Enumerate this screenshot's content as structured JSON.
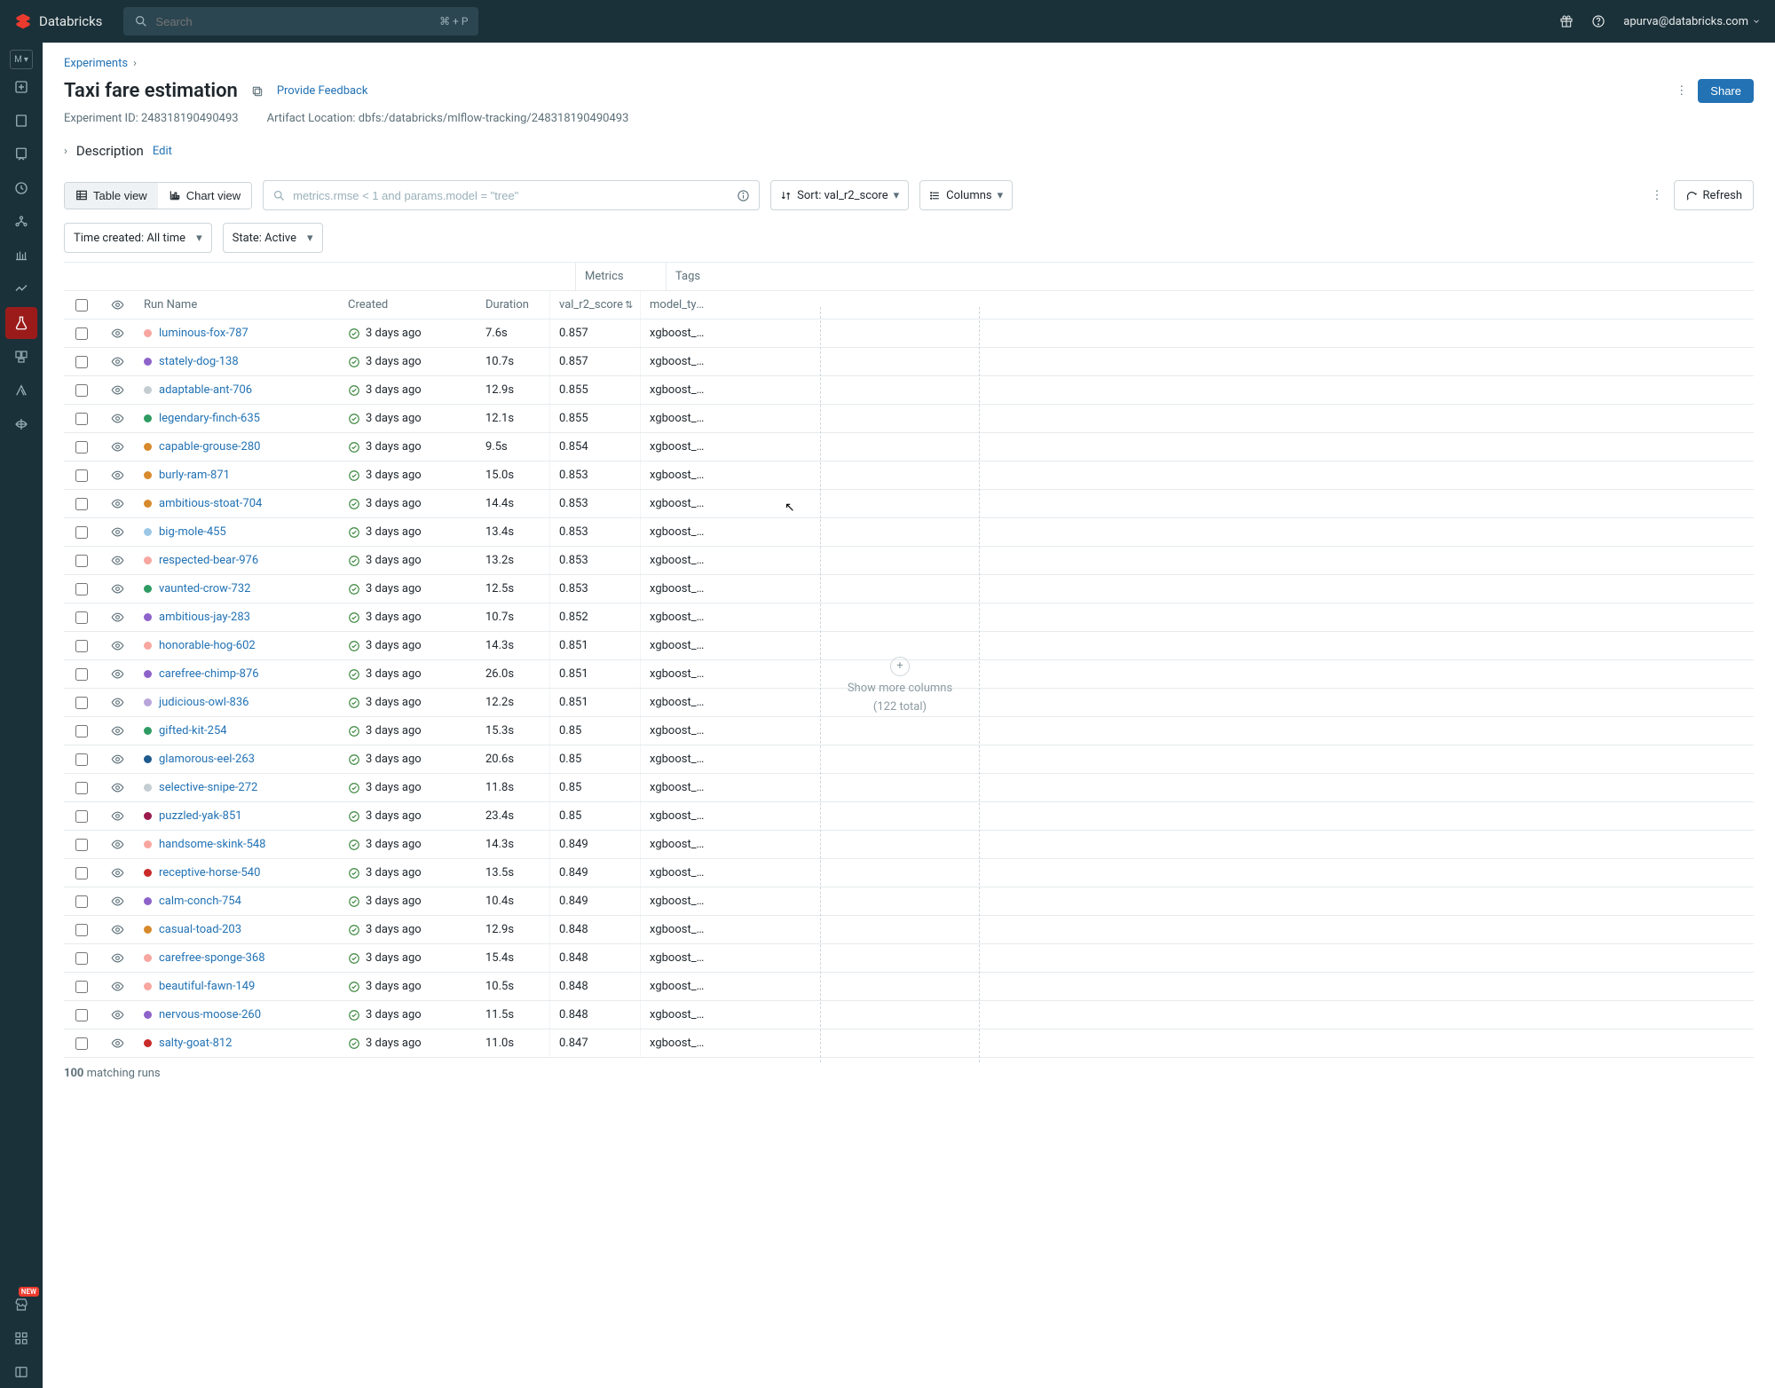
{
  "brand": "Databricks",
  "search": {
    "placeholder": "Search",
    "kbd": "⌘ + P"
  },
  "user": {
    "email": "apurva@databricks.com"
  },
  "breadcrumb": {
    "root": "Experiments"
  },
  "page": {
    "title": "Taxi fare estimation",
    "feedback": "Provide Feedback",
    "share": "Share",
    "experiment_id_label": "Experiment ID:",
    "experiment_id": "248318190490493",
    "artifact_label": "Artifact Location:",
    "artifact": "dbfs:/databricks/mlflow-tracking/248318190490493",
    "description_label": "Description",
    "edit": "Edit"
  },
  "toolbar": {
    "table_view": "Table view",
    "chart_view": "Chart view",
    "filter_placeholder": "metrics.rmse < 1 and params.model = \"tree\"",
    "sort_label": "Sort: val_r2_score",
    "columns": "Columns",
    "refresh": "Refresh",
    "time_filter": "Time created: All time",
    "state_filter": "State: Active"
  },
  "groups": {
    "metrics": "Metrics",
    "tags": "Tags"
  },
  "columns": {
    "run_name": "Run Name",
    "created": "Created",
    "duration": "Duration",
    "metric": "val_r2_score",
    "tag": "model_type"
  },
  "more_cols": {
    "line1": "Show more columns",
    "line2": "(122 total)"
  },
  "footer_count": "100 matching runs",
  "nav_badge": "NEW",
  "runs": [
    {
      "name": "luminous-fox-787",
      "dot": "#f7a6a0",
      "created": "3 days ago",
      "dur": "7.6s",
      "metric": "0.857",
      "tag": "xgboost_re..."
    },
    {
      "name": "stately-dog-138",
      "dot": "#8e63c9",
      "created": "3 days ago",
      "dur": "10.7s",
      "metric": "0.857",
      "tag": "xgboost_re..."
    },
    {
      "name": "adaptable-ant-706",
      "dot": "#c4cdd2",
      "created": "3 days ago",
      "dur": "12.9s",
      "metric": "0.855",
      "tag": "xgboost_re..."
    },
    {
      "name": "legendary-finch-635",
      "dot": "#2e9b63",
      "created": "3 days ago",
      "dur": "12.1s",
      "metric": "0.855",
      "tag": "xgboost_re..."
    },
    {
      "name": "capable-grouse-280",
      "dot": "#d78a2d",
      "created": "3 days ago",
      "dur": "9.5s",
      "metric": "0.854",
      "tag": "xgboost_re..."
    },
    {
      "name": "burly-ram-871",
      "dot": "#d78a2d",
      "created": "3 days ago",
      "dur": "15.0s",
      "metric": "0.853",
      "tag": "xgboost_re..."
    },
    {
      "name": "ambitious-stoat-704",
      "dot": "#d78a2d",
      "created": "3 days ago",
      "dur": "14.4s",
      "metric": "0.853",
      "tag": "xgboost_re..."
    },
    {
      "name": "big-mole-455",
      "dot": "#9cc8e6",
      "created": "3 days ago",
      "dur": "13.4s",
      "metric": "0.853",
      "tag": "xgboost_re..."
    },
    {
      "name": "respected-bear-976",
      "dot": "#f7a6a0",
      "created": "3 days ago",
      "dur": "13.2s",
      "metric": "0.853",
      "tag": "xgboost_re..."
    },
    {
      "name": "vaunted-crow-732",
      "dot": "#2e9b63",
      "created": "3 days ago",
      "dur": "12.5s",
      "metric": "0.853",
      "tag": "xgboost_re..."
    },
    {
      "name": "ambitious-jay-283",
      "dot": "#8e63c9",
      "created": "3 days ago",
      "dur": "10.7s",
      "metric": "0.852",
      "tag": "xgboost_re..."
    },
    {
      "name": "honorable-hog-602",
      "dot": "#f7a6a0",
      "created": "3 days ago",
      "dur": "14.3s",
      "metric": "0.851",
      "tag": "xgboost_re..."
    },
    {
      "name": "carefree-chimp-876",
      "dot": "#8e63c9",
      "created": "3 days ago",
      "dur": "26.0s",
      "metric": "0.851",
      "tag": "xgboost_re..."
    },
    {
      "name": "judicious-owl-836",
      "dot": "#b8a5da",
      "created": "3 days ago",
      "dur": "12.2s",
      "metric": "0.851",
      "tag": "xgboost_re..."
    },
    {
      "name": "gifted-kit-254",
      "dot": "#2e9b63",
      "created": "3 days ago",
      "dur": "15.3s",
      "metric": "0.85",
      "tag": "xgboost_re..."
    },
    {
      "name": "glamorous-eel-263",
      "dot": "#1e5a8e",
      "created": "3 days ago",
      "dur": "20.6s",
      "metric": "0.85",
      "tag": "xgboost_re..."
    },
    {
      "name": "selective-snipe-272",
      "dot": "#c4cdd2",
      "created": "3 days ago",
      "dur": "11.8s",
      "metric": "0.85",
      "tag": "xgboost_re..."
    },
    {
      "name": "puzzled-yak-851",
      "dot": "#9b1b4d",
      "created": "3 days ago",
      "dur": "23.4s",
      "metric": "0.85",
      "tag": "xgboost_re..."
    },
    {
      "name": "handsome-skink-548",
      "dot": "#f7a6a0",
      "created": "3 days ago",
      "dur": "14.3s",
      "metric": "0.849",
      "tag": "xgboost_re..."
    },
    {
      "name": "receptive-horse-540",
      "dot": "#c92a2a",
      "created": "3 days ago",
      "dur": "13.5s",
      "metric": "0.849",
      "tag": "xgboost_re..."
    },
    {
      "name": "calm-conch-754",
      "dot": "#8e63c9",
      "created": "3 days ago",
      "dur": "10.4s",
      "metric": "0.849",
      "tag": "xgboost_re..."
    },
    {
      "name": "casual-toad-203",
      "dot": "#d78a2d",
      "created": "3 days ago",
      "dur": "12.9s",
      "metric": "0.848",
      "tag": "xgboost_re..."
    },
    {
      "name": "carefree-sponge-368",
      "dot": "#f7a6a0",
      "created": "3 days ago",
      "dur": "15.4s",
      "metric": "0.848",
      "tag": "xgboost_re..."
    },
    {
      "name": "beautiful-fawn-149",
      "dot": "#f7a6a0",
      "created": "3 days ago",
      "dur": "10.5s",
      "metric": "0.848",
      "tag": "xgboost_re..."
    },
    {
      "name": "nervous-moose-260",
      "dot": "#8e63c9",
      "created": "3 days ago",
      "dur": "11.5s",
      "metric": "0.848",
      "tag": "xgboost_re..."
    },
    {
      "name": "salty-goat-812",
      "dot": "#c92a2a",
      "created": "3 days ago",
      "dur": "11.0s",
      "metric": "0.847",
      "tag": "xgboost_re..."
    }
  ]
}
